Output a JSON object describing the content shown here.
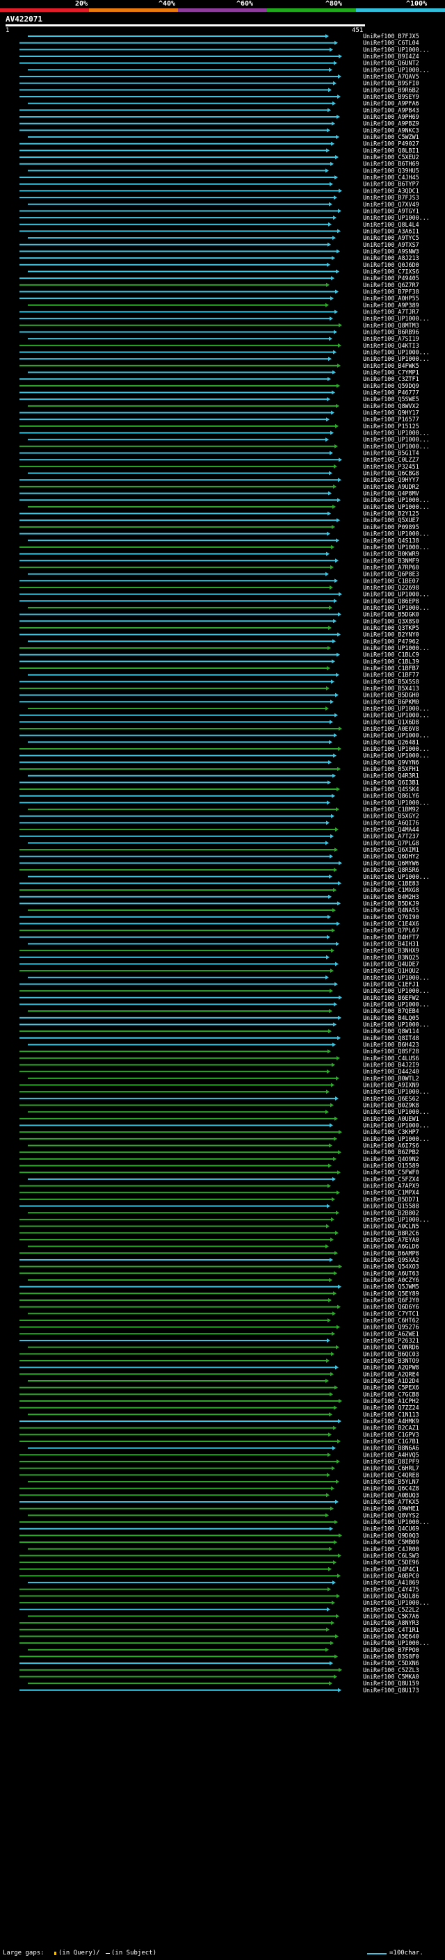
{
  "scale": {
    "percent_labels": [
      "20%",
      "^40%",
      "^60%",
      "^80%",
      "^100%"
    ],
    "colors": [
      "#e11d2a",
      "#e87a10",
      "#8e3d9c",
      "#21a81c",
      "#33bfdc"
    ]
  },
  "query": {
    "id": "AV422071",
    "start": "1",
    "end": "451"
  },
  "hit_colors": {
    "cyan": "#40c4e0",
    "green": "#2ea82a"
  },
  "hits": [
    "UniRef100_B7FJX5",
    "UniRef100_C6TL04",
    "UniRef100_UP1000...",
    "UniRef100_B9I4Z4",
    "UniRef100_Q6UNT2",
    "UniRef100_UP1000...",
    "UniRef100_A7QAV5",
    "UniRef100_B9SFI0",
    "UniRef100_B9R6B2",
    "UniRef100_B9SEY9",
    "UniRef100_A9PFA6",
    "UniRef100_A9PB43",
    "UniRef100_A9PH69",
    "UniRef100_A9PBZ9",
    "UniRef100_A9NKC3",
    "UniRef100_C5WZW1",
    "UniRef100_P49027",
    "UniRef100_Q8LBI1",
    "UniRef100_C5XEU2",
    "UniRef100_B6TH69",
    "UniRef100_Q39HU5",
    "UniRef100_C4JH45",
    "UniRef100_B6TYP7",
    "UniRef100_A3QDC1",
    "UniRef100_B7FJS3",
    "UniRef100_Q7XV49",
    "UniRef100_A9TGY1",
    "UniRef100_UP1000...",
    "UniRef100_Q8L4L4",
    "UniRef100_A3A6I1",
    "UniRef100_A9TYC5",
    "UniRef100_A9TXS7",
    "UniRef100_A9SNW3",
    "UniRef100_A8J213",
    "UniRef100_Q0J6D0",
    "UniRef100_C7IXS6",
    "UniRef100_P49405",
    "UniRef100_Q6Z7R7",
    "UniRef100_B7PF38",
    "UniRef100_A0HP55",
    "UniRef100_A9P389",
    "UniRef100_A7TJR7",
    "UniRef100_UP1000...",
    "UniRef100_Q8MTM3",
    "UniRef100_B6RB96",
    "UniRef100_A7SI19",
    "UniRef100_Q4KTI3",
    "UniRef100_UP1000...",
    "UniRef100_UP1000...",
    "UniRef100_B4FWK5",
    "UniRef100_C7YMP1",
    "UniRef100_C3ZTF1",
    "UniRef100_Q59DQ9",
    "UniRef100_P46777",
    "UniRef100_Q5SWE5",
    "UniRef100_Q8WVX2",
    "UniRef100_Q9HY17",
    "UniRef100_P16577",
    "UniRef100_P15125",
    "UniRef100_UP1000...",
    "UniRef100_UP1000...",
    "UniRef100_UP1000...",
    "UniRef100_B5G1T4",
    "UniRef100_C0LZZ7",
    "UniRef100_P32451",
    "UniRef100_Q6CBG8",
    "UniRef100_Q9HYY7",
    "UniRef100_A9UDR2",
    "UniRef100_Q4P8MV",
    "UniRef100_UP1000...",
    "UniRef100_UP1000...",
    "UniRef100_B2Y125",
    "UniRef100_Q5XUE7",
    "UniRef100_P09895",
    "UniRef100_UP1000...",
    "UniRef100_Q4S138",
    "UniRef100_UP1000...",
    "UniRef100_B0KWR9",
    "UniRef100_B3NMF9",
    "UniRef100_A7RP60",
    "UniRef100_Q6P8E3",
    "UniRef100_C1BE07",
    "UniRef100_Q22698",
    "UniRef100_UP1000...",
    "UniRef100_Q86EP8",
    "UniRef100_UP1000...",
    "UniRef100_B5DGK0",
    "UniRef100_Q3X8S0",
    "UniRef100_Q3TKP5",
    "UniRef100_B2YNY0",
    "UniRef100_P47962",
    "UniRef100_UP1000...",
    "UniRef100_C1BLC9",
    "UniRef100_C1BL39",
    "UniRef100_C1BFB7",
    "UniRef100_C1BF77",
    "UniRef100_B5X5S8",
    "UniRef100_B5X413",
    "UniRef100_B5DGH0",
    "UniRef100_B6PKM0",
    "UniRef100_UP1000...",
    "UniRef100_UP1000...",
    "UniRef100_Q1X6D8",
    "UniRef100_A0E6V8",
    "UniRef100_UP1000...",
    "UniRef100_Q26481",
    "UniRef100_UP1000...",
    "UniRef100_UP1000...",
    "UniRef100_Q9VYN6",
    "UniRef100_B5XFH1",
    "UniRef100_Q4R3R1",
    "UniRef100_Q6I3B1",
    "UniRef100_Q4SSK4",
    "UniRef100_Q86LY6",
    "UniRef100_UP1000...",
    "UniRef100_C1BM92",
    "UniRef100_B5XGY2",
    "UniRef100_A6QI76",
    "UniRef100_Q4MA44",
    "UniRef100_A7T237",
    "UniRef100_Q7PLG8",
    "UniRef100_Q6XIM1",
    "UniRef100_Q6DHY2",
    "UniRef100_Q6MYW6",
    "UniRef100_Q8RSR6",
    "UniRef100_UP1000...",
    "UniRef100_C1BE83",
    "UniRef100_C1MXG8",
    "UniRef100_B4M2H3",
    "UniRef100_B5DKJ9",
    "UniRef100_Q4NA55",
    "UniRef100_Q76I90",
    "UniRef100_C1E4X6",
    "UniRef100_Q7PL67",
    "UniRef100_B4HFT7",
    "UniRef100_B4IH31",
    "UniRef100_B3NHX9",
    "UniRef100_B3NQ25",
    "UniRef100_Q4UDE7",
    "UniRef100_Q1HQU2",
    "UniRef100_UP1000...",
    "UniRef100_C1EFJ1",
    "UniRef100_UP1000...",
    "UniRef100_B6EFW2",
    "UniRef100_UP1000...",
    "UniRef100_B7QEB4",
    "UniRef100_B4LQ05",
    "UniRef100_UP1000...",
    "UniRef100_Q8W114",
    "UniRef100_Q8IT48",
    "UniRef100_B6H423",
    "UniRef100_Q8SF28",
    "UniRef100_C4LUS6",
    "UniRef100_B4J2I9",
    "UniRef100_Q44240",
    "UniRef100_B0WTL2",
    "UniRef100_A9IXN9",
    "UniRef100_UP1000...",
    "UniRef100_Q6ES62",
    "UniRef100_B0Z9K8",
    "UniRef100_UP1000...",
    "UniRef100_A0UEW1",
    "UniRef100_UP1000...",
    "UniRef100_C3KHP7",
    "UniRef100_UP1000...",
    "UniRef100_A6I7S6",
    "UniRef100_B6ZPB2",
    "UniRef100_Q4O9N2",
    "UniRef100_O15589",
    "UniRef100_C5FWF0",
    "UniRef100_C5FZX4",
    "UniRef100_A7APX9",
    "UniRef100_C1MPX4",
    "UniRef100_B5DD71",
    "UniRef100_Q15588",
    "UniRef100_B2B802",
    "UniRef100_UP1000...",
    "UniRef100_A0CLN5",
    "UniRef100_B8R2C6",
    "UniRef100_A7EYA0",
    "UniRef100_A6GLD6",
    "UniRef100_B6AMP8",
    "UniRef100_Q9SXA2",
    "UniRef100_Q54XO3",
    "UniRef100_A6UT63",
    "UniRef100_A0CZY6",
    "UniRef100_Q5JWM5",
    "UniRef100_Q5EY89",
    "UniRef100_Q6FJY0",
    "UniRef100_Q6D6Y6",
    "UniRef100_C7YTC1",
    "UniRef100_C6HT62",
    "UniRef100_Q95276",
    "UniRef100_A6ZWE1",
    "UniRef100_P26321",
    "UniRef100_C0NRD6",
    "UniRef100_B6QC03",
    "UniRef100_B3NTO9",
    "UniRef100_A2QPW8",
    "UniRef100_A2QRE4",
    "UniRef100_A1D2D4",
    "UniRef100_C5PEX6",
    "UniRef100_C7GCB8",
    "UniRef100_A1CPH2",
    "UniRef100_Q7ZZ24",
    "UniRef100_C1N113",
    "UniRef100_A4HMK9",
    "UniRef100_B2CAZ1",
    "UniRef100_C1GPV3",
    "UniRef100_C1G7B1",
    "UniRef100_B8N6A6",
    "UniRef100_A4HVQ5",
    "UniRef100_Q8IPF9",
    "UniRef100_C6HRL7",
    "UniRef100_C4QRE8",
    "UniRef100_B5YLN7",
    "UniRef100_Q6C4Z8",
    "UniRef100_A0BUQ3",
    "UniRef100_A7TKX5",
    "UniRef100_Q9WHE1",
    "UniRef100_Q8VYS2",
    "UniRef100_UP1000...",
    "UniRef100_Q4CU69",
    "UniRef100_Q9D0Q3",
    "UniRef100_C5MB09",
    "UniRef100_C4JR00",
    "UniRef100_C6LSW3",
    "UniRef100_C5DE96",
    "UniRef100_Q4P4C1",
    "UniRef100_A0BPC0",
    "UniRef100_A41869",
    "UniRef100_C4Y475",
    "UniRef100_A5DL86",
    "UniRef100_UP1000...",
    "UniRef100_C5Z2L2",
    "UniRef100_C5K7A6",
    "UniRef100_A8NYR3",
    "UniRef100_C4T1R1",
    "UniRef100_A5E640",
    "UniRef100_UP1000...",
    "UniRef100_B7FPO0",
    "UniRef100_B3S8F0",
    "UniRef100_C5DXN6",
    "UniRef100_C5ZZL3",
    "UniRef100_C5MKA0",
    "UniRef100_Q8U159",
    "UniRef100_Q8U173"
  ],
  "footer": {
    "gaps_label": "Large gaps:",
    "in_query": "(in Query)/",
    "in_subject": "(in Subject)",
    "scale_note": "=100char."
  }
}
